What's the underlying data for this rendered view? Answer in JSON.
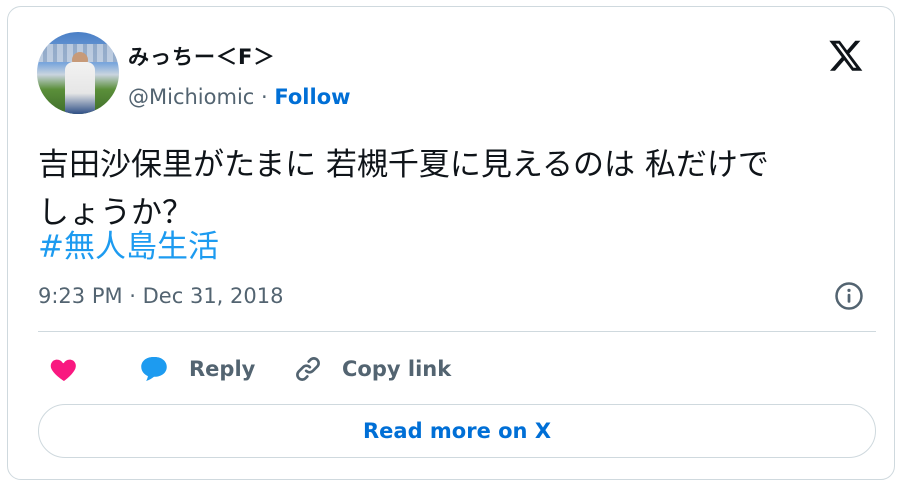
{
  "author": {
    "display_name": "みっちー＜F＞",
    "handle": "@Michiomic",
    "separator": "·",
    "follow_label": "Follow"
  },
  "tweet": {
    "line1": "吉田沙保里がたまに 若槻千夏に見えるのは 私だけで",
    "line2": "しょうか？",
    "hashtag": "#無人島生活",
    "timestamp": "9:23 PM · Dec 31, 2018"
  },
  "actions": {
    "reply_label": "Reply",
    "copy_link_label": "Copy link"
  },
  "read_more_label": "Read more on X",
  "icons": {
    "logo": "x-logo-icon",
    "info": "info-icon",
    "like": "heart-icon",
    "reply": "speech-bubble-icon",
    "copy": "link-icon"
  },
  "colors": {
    "link": "#006fd6",
    "hashtag": "#1d9bf0",
    "heart": "#f91880",
    "muted": "#536471",
    "border": "#cfd9de"
  }
}
